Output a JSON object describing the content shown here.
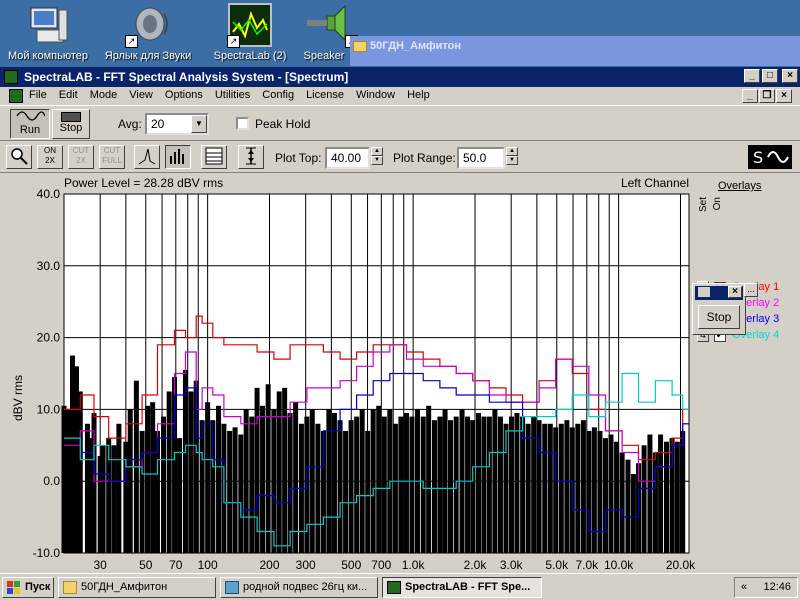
{
  "desktop": {
    "icons": [
      {
        "label": "Мой компьютер",
        "icon": "computer-icon"
      },
      {
        "label": "Ярлык для Звуки",
        "icon": "speaker-sounds-icon"
      },
      {
        "label": "SpectraLab (2)",
        "icon": "spectralab-icon"
      },
      {
        "label": "Speaker",
        "icon": "speaker-icon"
      }
    ],
    "background_window_title": "50ГДН_Амфитон"
  },
  "window": {
    "title": "SpectraLAB - FFT Spectral Analysis System - [Spectrum]",
    "menu": [
      "File",
      "Edit",
      "Mode",
      "View",
      "Options",
      "Utilities",
      "Config",
      "License",
      "Window",
      "Help"
    ]
  },
  "toolbar": {
    "run_label": "Run",
    "stop_label": "Stop",
    "avg_label": "Avg:",
    "avg_value": "20",
    "peak_hold_label": "Peak Hold",
    "plot_top_label": "Plot Top:",
    "plot_top_value": "40.00",
    "plot_range_label": "Plot Range:",
    "plot_range_value": "50.0",
    "icons": [
      "zoom-icon",
      "on-2x-icon",
      "cut-2x-icon",
      "cut-full-icon",
      "line-graph-icon",
      "bar-graph-icon",
      "data-table-icon",
      "vertical-scale-icon",
      "spectrum-logo-icon"
    ]
  },
  "graph": {
    "power_level": "Power Level = 28.28 dBV rms",
    "channel": "Left Channel",
    "y_axis_label": "dBV rms",
    "y_ticks": [
      "40.0",
      "30.0",
      "20.0",
      "10.0",
      "0.0",
      "-10.0"
    ],
    "x_ticks": [
      "30",
      "50",
      "70",
      "100",
      "200",
      "300",
      "500",
      "700",
      "1.0k",
      "2.0k",
      "3.0k",
      "5.0k",
      "7.0k",
      "10.0k",
      "20.0k"
    ]
  },
  "overlays": {
    "title": "Overlays",
    "set_label": "Set",
    "on_label": "On",
    "items": [
      {
        "set": "1",
        "name": "Overlay 1",
        "color": "#ff0000",
        "checked": "✔"
      },
      {
        "set": "2",
        "name": "Overlay 2",
        "color": "#ff00ff",
        "checked": "✔"
      },
      {
        "set": "3",
        "name": "Overlay 3",
        "color": "#0000ff",
        "checked": "✔"
      },
      {
        "set": "4",
        "name": "Overlay 4",
        "color": "#00d8d8",
        "checked": "✔"
      }
    ],
    "mini_stop_label": "Stop"
  },
  "taskbar": {
    "start_label": "Пуск",
    "tasks": [
      "50ГДН_Амфитон",
      "родной подвес 26гц ки...",
      "SpectraLAB - FFT Spe..."
    ],
    "clock": "12:46"
  },
  "chart_data": {
    "type": "bar",
    "xscale": "log",
    "xlim": [
      20,
      22000
    ],
    "ylim": [
      -10,
      40
    ],
    "ylabel": "dBV rms",
    "grid": true,
    "bars": {
      "x": [
        20,
        21,
        22,
        23,
        24,
        26,
        27,
        28,
        30,
        31,
        33,
        35,
        37,
        40,
        42,
        45,
        48,
        51,
        54,
        57,
        61,
        65,
        69,
        73,
        78,
        83,
        88,
        94,
        100,
        106,
        113,
        120,
        128,
        136,
        145,
        154,
        164,
        174,
        185,
        197,
        210,
        223,
        237,
        252,
        268,
        286,
        304,
        323,
        344,
        366,
        389,
        414,
        441,
        469,
        499,
        531,
        565,
        601,
        639,
        680,
        724,
        770,
        820,
        872,
        928,
        987,
        1050,
        1120,
        1190,
        1270,
        1350,
        1430,
        1520,
        1620,
        1730,
        1840,
        1950,
        2080,
        2210,
        2350,
        2500,
        2660,
        2830,
        3010,
        3200,
        3410,
        3630,
        3860,
        4100,
        4370,
        4650,
        4940,
        5260,
        5600,
        5950,
        6330,
        6740,
        7170,
        7620,
        8110,
        8630,
        9180,
        9770,
        10400,
        11100,
        11800,
        12500,
        13300,
        14200,
        15100,
        16000,
        17100,
        18200,
        19300,
        20500
      ],
      "y": [
        10.5,
        10,
        17.5,
        16,
        12.5,
        8,
        6,
        9.5,
        3.5,
        5,
        6,
        5,
        8,
        5.5,
        10,
        14,
        7,
        10.5,
        11,
        7,
        9,
        12.5,
        14.5,
        6,
        15.5,
        12.5,
        14,
        8.5,
        11,
        8.5,
        10.5,
        8,
        7,
        7.5,
        6.5,
        10,
        9,
        13,
        10.5,
        13.5,
        10,
        12.5,
        13,
        9.5,
        11,
        8,
        9,
        10,
        8,
        7,
        10,
        9.5,
        8.5,
        7,
        8.5,
        9,
        10,
        7,
        10,
        10.5,
        9,
        10,
        8,
        9,
        9.5,
        9,
        10,
        9,
        10.5,
        8.5,
        9,
        10,
        8.5,
        9,
        10,
        9,
        8.5,
        9.5,
        9,
        9,
        10,
        9,
        8,
        9,
        9.5,
        9,
        8,
        9,
        8.5,
        8,
        8,
        7.5,
        8,
        8.5,
        7.5,
        8,
        8.5,
        7,
        7.5,
        7,
        6,
        6.5,
        5.5,
        4,
        3,
        1,
        2.5,
        5,
        6.5,
        4,
        6.5,
        5.5,
        6,
        5.5,
        7
      ]
    },
    "series": [
      {
        "name": "Overlay 1",
        "color": "#dd0000",
        "x": [
          20,
          24,
          28,
          33,
          40,
          48,
          57,
          69,
          78,
          88,
          94,
          106,
          120,
          145,
          174,
          210,
          252,
          304,
          366,
          441,
          531,
          639,
          770,
          928,
          1120,
          1350,
          1620,
          1950,
          2350,
          2830,
          3410,
          4100,
          4940,
          5950,
          7170,
          8630,
          10400,
          12500,
          15100,
          18200,
          20500
        ],
        "y": [
          10,
          12,
          9,
          6,
          8,
          12,
          19,
          21,
          20,
          23,
          22,
          20,
          19,
          19,
          18,
          17,
          19,
          19,
          18,
          17,
          18,
          19,
          19,
          18,
          17,
          16,
          15,
          14,
          13,
          12,
          11,
          14,
          17,
          15,
          10,
          7,
          5,
          3,
          4,
          6,
          10
        ]
      },
      {
        "name": "Overlay 2",
        "color": "#cc00cc",
        "x": [
          20,
          24,
          28,
          33,
          40,
          48,
          57,
          69,
          78,
          88,
          94,
          106,
          120,
          145,
          174,
          210,
          252,
          304,
          366,
          441,
          531,
          639,
          770,
          928,
          1120,
          1350,
          1620,
          1950,
          2350,
          2830,
          3410,
          4100,
          4940,
          5950,
          7170,
          8630,
          10400,
          12500,
          15100,
          18200,
          20500
        ],
        "y": [
          5,
          7,
          0,
          0,
          2,
          4,
          8,
          15,
          18,
          10,
          13,
          12,
          9,
          8,
          9,
          9,
          11,
          13,
          13,
          14,
          16,
          18,
          19,
          17,
          16,
          16,
          15,
          14,
          12,
          11,
          11,
          13,
          17,
          16,
          12,
          7,
          4,
          0,
          2,
          5,
          8
        ]
      },
      {
        "name": "Overlay 3",
        "color": "#0000cc",
        "x": [
          20,
          24,
          28,
          33,
          40,
          48,
          57,
          69,
          78,
          88,
          94,
          106,
          120,
          145,
          174,
          210,
          252,
          304,
          366,
          441,
          531,
          639,
          770,
          928,
          1120,
          1350,
          1620,
          1950,
          2350,
          2830,
          3410,
          4100,
          4940,
          5950,
          7170,
          8630,
          10400,
          12500,
          15100,
          18200,
          20500
        ],
        "y": [
          6,
          4,
          1,
          0,
          3,
          4,
          6,
          12,
          13,
          6,
          8,
          3,
          -3,
          -4,
          -2,
          -3,
          -1,
          2,
          7,
          10,
          12,
          14,
          15,
          15,
          14,
          13,
          12,
          12,
          11,
          11,
          6,
          4,
          0,
          -4,
          -7,
          -4,
          -5,
          -1,
          2,
          5,
          8
        ]
      },
      {
        "name": "Overlay 4",
        "color": "#00cccc",
        "x": [
          20,
          24,
          28,
          33,
          40,
          48,
          57,
          69,
          78,
          88,
          94,
          106,
          120,
          145,
          174,
          210,
          252,
          304,
          366,
          441,
          531,
          639,
          770,
          928,
          1120,
          1350,
          1620,
          1950,
          2350,
          2830,
          3410,
          4100,
          4940,
          5950,
          7170,
          8630,
          10400,
          12500,
          15100,
          18200,
          20500
        ],
        "y": [
          6,
          3,
          5,
          3,
          2,
          1,
          3,
          4,
          5,
          4,
          3,
          2,
          -3,
          -5,
          -7,
          -9,
          -7,
          -6,
          -5,
          -3,
          -2,
          -1,
          0,
          0,
          -1,
          -1,
          0,
          2,
          4,
          7,
          9,
          9,
          10,
          12,
          9,
          11,
          15,
          11,
          14,
          12,
          10
        ]
      }
    ]
  }
}
